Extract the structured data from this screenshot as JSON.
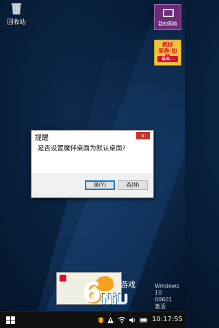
{
  "desktop": {
    "recycle_bin_label": "回收站",
    "tiles": [
      {
        "label": "我的网络"
      },
      {
        "line1": "抓好",
        "line2": "奖券·加薪",
        "line3": "最高..."
      }
    ]
  },
  "dialog": {
    "title": "提醒",
    "close_glyph": "x",
    "message": "是否设置魔伴桌面为默认桌面?",
    "yes_label": "是(Y)",
    "no_label": "否(N)"
  },
  "watermark": {
    "six": "6",
    "niu": "NiU",
    "game": "游戏"
  },
  "overlay_text": {
    "win10_line1": "Windows 10",
    "win10_line2": "00601",
    "win10_line3": "激活"
  },
  "taskbar": {
    "clock": "10:17:55"
  },
  "colors": {
    "dialog_close": "#c7342b",
    "taskbar": "#101010",
    "desktop": "#08203d"
  }
}
